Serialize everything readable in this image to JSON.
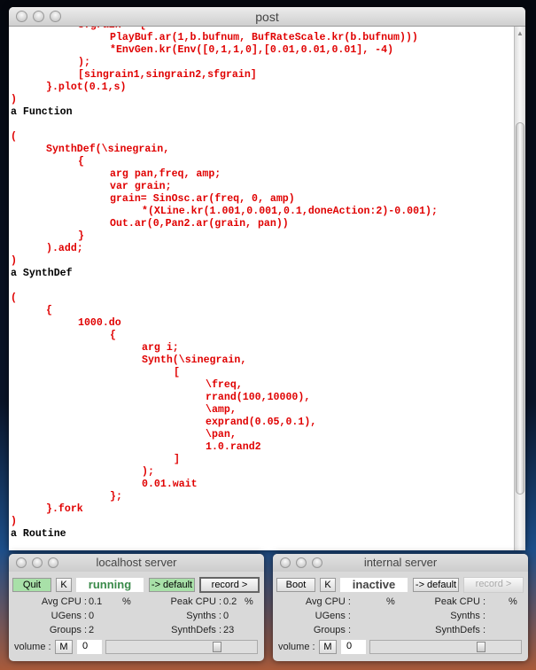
{
  "post": {
    "title": "post",
    "lines": [
      {
        "i": 2,
        "t": "sfgrain = {",
        "r": false
      },
      {
        "i": 3,
        "t": "PlayBuf.ar(1,b.bufnum, BufRateScale.kr(b.bufnum)))",
        "r": false
      },
      {
        "i": 3,
        "t": "*EnvGen.kr(Env([0,1,1,0],[0.01,0.01,0.01], -4)",
        "r": false
      },
      {
        "i": 2,
        "t": ");",
        "r": false
      },
      {
        "i": 2,
        "t": "[singrain1,singrain2,sfgrain]",
        "r": false
      },
      {
        "i": 1,
        "t": "}.plot(0.1,s)",
        "r": false
      },
      {
        "i": 0,
        "t": ")",
        "r": false
      },
      {
        "i": 0,
        "t": "a Function",
        "r": true
      },
      {
        "i": 0,
        "t": "",
        "r": false
      },
      {
        "i": 0,
        "t": "(",
        "r": false
      },
      {
        "i": 1,
        "t": "SynthDef(\\sinegrain,",
        "r": false
      },
      {
        "i": 2,
        "t": "{",
        "r": false
      },
      {
        "i": 3,
        "t": "arg pan,freq, amp;",
        "r": false
      },
      {
        "i": 3,
        "t": "var grain;",
        "r": false
      },
      {
        "i": 3,
        "t": "grain= SinOsc.ar(freq, 0, amp)",
        "r": false
      },
      {
        "i": 4,
        "t": "*(XLine.kr(1.001,0.001,0.1,doneAction:2)-0.001);",
        "r": false
      },
      {
        "i": 3,
        "t": "Out.ar(0,Pan2.ar(grain, pan))",
        "r": false
      },
      {
        "i": 2,
        "t": "}",
        "r": false
      },
      {
        "i": 1,
        "t": ").add;",
        "r": false
      },
      {
        "i": 0,
        "t": ")",
        "r": false
      },
      {
        "i": 0,
        "t": "a SynthDef",
        "r": true
      },
      {
        "i": 0,
        "t": "",
        "r": false
      },
      {
        "i": 0,
        "t": "(",
        "r": false
      },
      {
        "i": 1,
        "t": "{",
        "r": false
      },
      {
        "i": 2,
        "t": "1000.do",
        "r": false
      },
      {
        "i": 3,
        "t": "{",
        "r": false
      },
      {
        "i": 4,
        "t": "arg i;",
        "r": false
      },
      {
        "i": 4,
        "t": "Synth(\\sinegrain,",
        "r": false
      },
      {
        "i": 5,
        "t": "[",
        "r": false
      },
      {
        "i": 6,
        "t": "\\freq,",
        "r": false
      },
      {
        "i": 6,
        "t": "rrand(100,10000),",
        "r": false
      },
      {
        "i": 6,
        "t": "\\amp,",
        "r": false
      },
      {
        "i": 6,
        "t": "exprand(0.05,0.1),",
        "r": false
      },
      {
        "i": 6,
        "t": "\\pan,",
        "r": false
      },
      {
        "i": 6,
        "t": "1.0.rand2",
        "r": false
      },
      {
        "i": 5,
        "t": "]",
        "r": false
      },
      {
        "i": 4,
        "t": ");",
        "r": false
      },
      {
        "i": 4,
        "t": "0.01.wait",
        "r": false
      },
      {
        "i": 3,
        "t": "};",
        "r": false
      },
      {
        "i": 1,
        "t": "}.fork",
        "r": false
      },
      {
        "i": 0,
        "t": ")",
        "r": false
      },
      {
        "i": 0,
        "t": "a Routine",
        "r": true
      }
    ]
  },
  "localhost": {
    "title": "localhost server",
    "boot": "Quit",
    "kill": "K",
    "status": "running",
    "default": "-> default",
    "record": "record >",
    "avg_cpu_label": "Avg CPU :",
    "avg_cpu": "0.1",
    "pct": "%",
    "peak_cpu_label": "Peak CPU :",
    "peak_cpu": "0.2",
    "ugens_label": "UGens :",
    "ugens": "0",
    "synths_label": "Synths :",
    "synths": "0",
    "groups_label": "Groups :",
    "groups": "2",
    "synthdefs_label": "SynthDefs :",
    "synthdefs": "23",
    "volume_label": "volume :",
    "mute": "M",
    "volume": "0",
    "volume_level": 0.75,
    "status_color": "#3a8a4a"
  },
  "internal": {
    "title": "internal server",
    "boot": "Boot",
    "kill": "K",
    "status": "inactive",
    "default": "-> default",
    "record": "record >",
    "avg_cpu_label": "Avg CPU :",
    "avg_cpu": "",
    "pct": "%",
    "peak_cpu_label": "Peak CPU :",
    "peak_cpu": "",
    "ugens_label": "UGens :",
    "ugens": "",
    "synths_label": "Synths :",
    "synths": "",
    "groups_label": "Groups :",
    "groups": "",
    "synthdefs_label": "SynthDefs :",
    "synthdefs": "",
    "volume_label": "volume :",
    "mute": "M",
    "volume": "0",
    "volume_level": 0.75,
    "status_color": "#444444"
  }
}
